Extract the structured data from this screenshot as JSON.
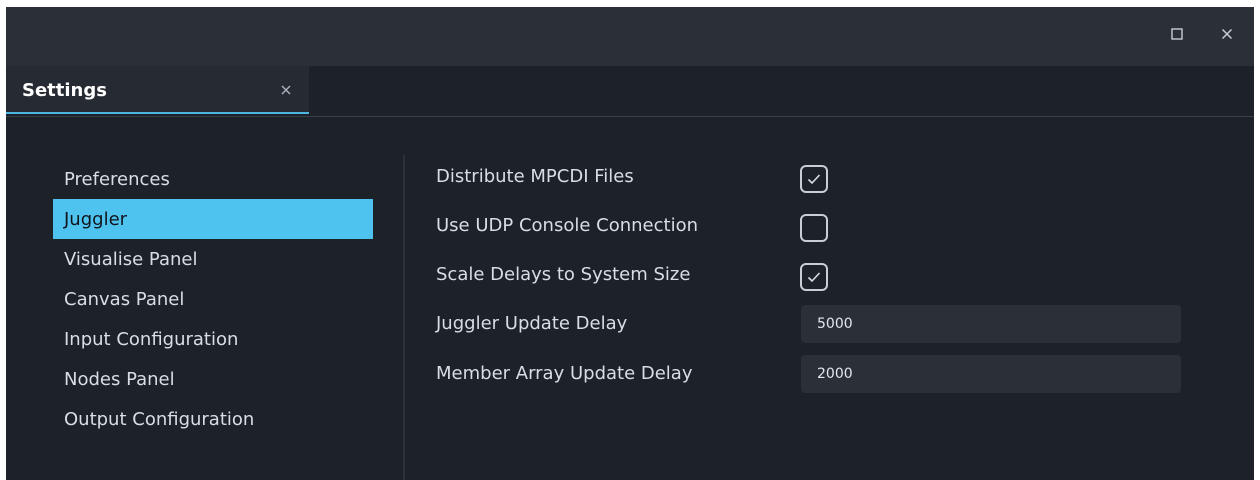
{
  "window": {
    "maximize_icon": "maximize-icon",
    "close_icon": "close-icon"
  },
  "tab": {
    "label": "Settings",
    "close_icon": "close-icon",
    "accent_color": "#4db5e2"
  },
  "sidebar": {
    "active_color": "#4fc3f0",
    "items": [
      {
        "label": "Preferences"
      },
      {
        "label": "Juggler"
      },
      {
        "label": "Visualise Panel"
      },
      {
        "label": "Canvas Panel"
      },
      {
        "label": "Input Configuration"
      },
      {
        "label": "Nodes Panel"
      },
      {
        "label": "Output Configuration"
      }
    ]
  },
  "settings": {
    "distribute_mpcdi": {
      "label": "Distribute MPCDI Files",
      "checked": true
    },
    "use_udp": {
      "label": "Use UDP Console Connection",
      "checked": false
    },
    "scale_delays": {
      "label": "Scale Delays to System Size",
      "checked": true
    },
    "juggler_update_delay": {
      "label": "Juggler Update Delay",
      "value": "5000"
    },
    "member_array_update_delay": {
      "label": "Member Array Update Delay",
      "value": "2000"
    }
  }
}
